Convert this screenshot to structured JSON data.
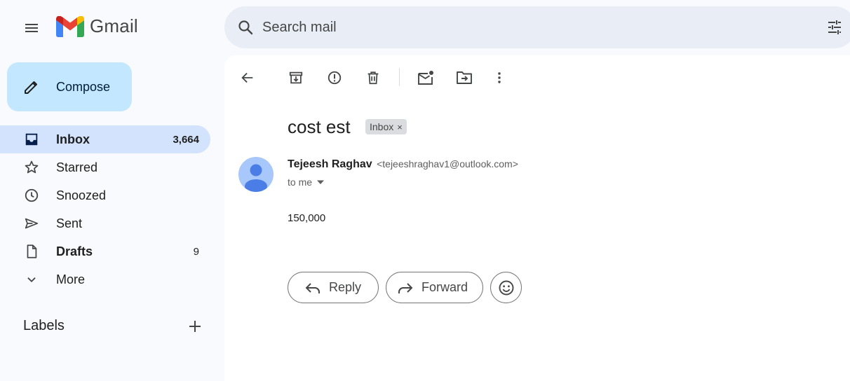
{
  "header": {
    "app_name": "Gmail",
    "search_placeholder": "Search mail"
  },
  "sidebar": {
    "compose_label": "Compose",
    "items": [
      {
        "label": "Inbox",
        "count": "3,664",
        "icon": "inbox-icon",
        "active": true,
        "bold": true
      },
      {
        "label": "Starred",
        "count": "",
        "icon": "star-icon",
        "active": false,
        "bold": false
      },
      {
        "label": "Snoozed",
        "count": "",
        "icon": "clock-icon",
        "active": false,
        "bold": false
      },
      {
        "label": "Sent",
        "count": "",
        "icon": "send-icon",
        "active": false,
        "bold": false
      },
      {
        "label": "Drafts",
        "count": "9",
        "icon": "draft-icon",
        "active": false,
        "bold": true
      },
      {
        "label": "More",
        "count": "",
        "icon": "chevron-down-icon",
        "active": false,
        "bold": false
      }
    ],
    "labels_heading": "Labels"
  },
  "toolbar": {
    "icons": [
      "back-arrow-icon",
      "archive-icon",
      "report-spam-icon",
      "delete-icon",
      "mark-unread-icon",
      "move-to-icon",
      "more-vert-icon"
    ]
  },
  "message": {
    "subject": "cost est",
    "label_chip": "Inbox",
    "chip_close": "×",
    "sender_name": "Tejeesh Raghav",
    "sender_email": "<tejeeshraghav1@outlook.com>",
    "recipient": "to me",
    "body": "150,000"
  },
  "actions": {
    "reply_label": "Reply",
    "forward_label": "Forward"
  },
  "colors": {
    "background": "#f8fafd",
    "compose_bg": "#c2e7ff",
    "active_nav_bg": "#d3e3fd",
    "search_bg": "#e9eef6",
    "avatar_bg": "#a8c7fa",
    "avatar_fg": "#4a7ee6"
  }
}
